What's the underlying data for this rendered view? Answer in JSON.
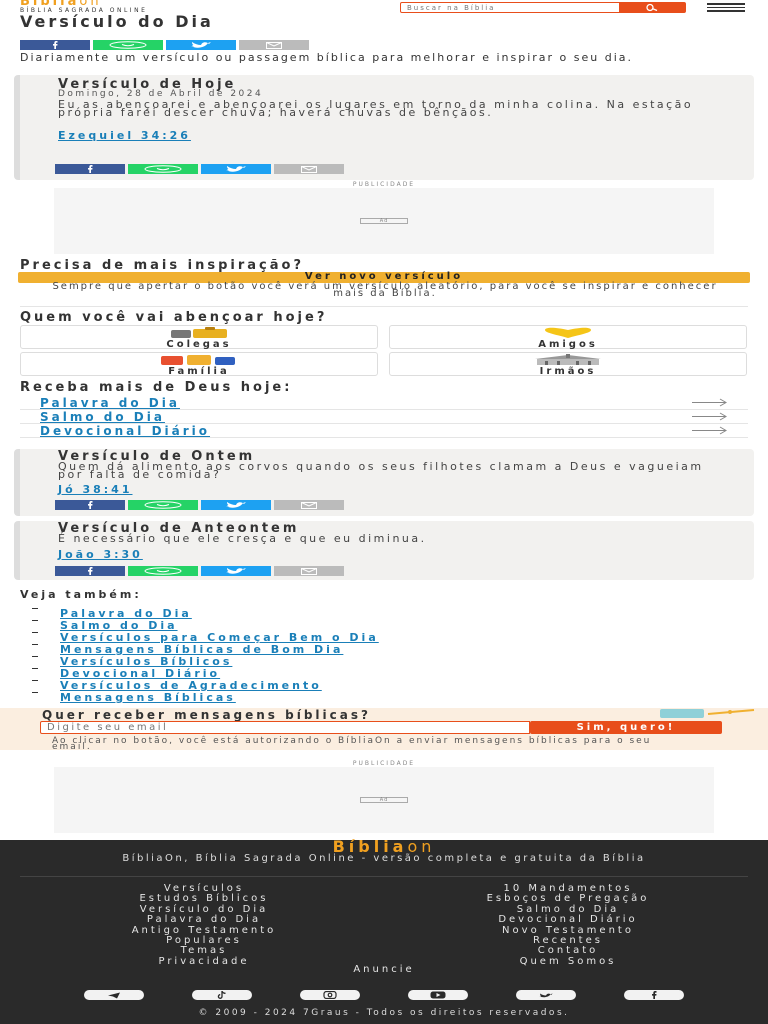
{
  "header": {
    "logo_main": "Bíblia",
    "logo_accent": "on",
    "logo_sub": "BÍBLIA SAGRADA ONLINE",
    "search_placeholder": "Buscar na Bíblia"
  },
  "page": {
    "title": "Versículo do Dia",
    "intro": "Diariamente um versículo ou passagem bíblica para melhorar e inspirar o seu dia."
  },
  "today": {
    "title": "Versículo de Hoje",
    "date": "Domingo, 28 de Abril de 2024",
    "text": "Eu as abençoarei e abençoarei os lugares em torno da minha colina. Na estação própria farei descer chuva; haverá chuvas de bênçãos.",
    "reference": "Ezequiel 34:26"
  },
  "ads": {
    "label": "PUBLICIDADE",
    "badge": "Ad"
  },
  "inspiration": {
    "title": "Precisa de mais inspiração?",
    "button": "Ver novo versículo",
    "note": "Sempre que apertar o botão você verá um versículo aleatório, para você se inspirar e conhecer mais da Bíblia."
  },
  "bless": {
    "title": "Quem você vai abençoar hoje?",
    "items": [
      "Colegas",
      "Amigos",
      "Família",
      "Irmãos"
    ]
  },
  "receive": {
    "title": "Receba mais de Deus hoje:",
    "links": [
      "Palavra do Dia",
      "Salmo do Dia",
      "Devocional Diário"
    ]
  },
  "yesterday": {
    "title": "Versículo de Ontem",
    "text": "Quem dá alimento aos corvos quando os seus filhotes clamam a Deus e vagueiam por falta de comida?",
    "reference": "Jó 38:41"
  },
  "day_before": {
    "title": "Versículo de Anteontem",
    "text": "É necessário que ele cresça e que eu diminua.",
    "reference": "João 3:30"
  },
  "see_also": {
    "title": "Veja também:",
    "links": [
      "Palavra do Dia",
      "Salmo do Dia",
      "Versículos para Começar Bem o Dia",
      "Mensagens Bíblicas de Bom Dia",
      "Versículos Bíblicos",
      "Devocional Diário",
      "Versículos de Agradecimento",
      "Mensagens Bíblicas"
    ]
  },
  "newsletter": {
    "title": "Quer receber mensagens bíblicas?",
    "placeholder": "Digite seu email",
    "button": "Sim, quero!",
    "note": "Ao clicar no botão, você está autorizando o BíbliaOn a enviar mensagens bíblicas para o seu email."
  },
  "footer": {
    "logo_main": "Bíblia",
    "logo_accent": "on",
    "tagline": "BíbliaOn, Bíblia Sagrada Online - versão completa e gratuita da Bíblia",
    "col_left": [
      "Versículos",
      "Estudos Bíblicos",
      "Versículo do Dia",
      "Palavra do Dia",
      "Antigo Testamento",
      "Populares",
      "Temas",
      "Privacidade"
    ],
    "col_right": [
      "10 Mandamentos",
      "Esboços de Pregação",
      "Salmo do Dia",
      "Devocional Diário",
      "Novo Testamento",
      "Recentes",
      "Contato",
      "Quem Somos"
    ],
    "advertise": "Anuncie",
    "social_icons": [
      "telegram-icon",
      "tiktok-icon",
      "instagram-icon",
      "youtube-icon",
      "twitter-icon",
      "facebook-icon"
    ],
    "copyright": "© 2009 - 2024 7Graus - Todos os direitos reservados."
  },
  "colors": {
    "accent": "#f0a020",
    "brand_red": "#e84e1b",
    "link": "#1a7fb8",
    "facebook": "#3b5998",
    "whatsapp": "#25d366",
    "twitter": "#1da1f2",
    "footer_bg": "#2a2a2a"
  }
}
